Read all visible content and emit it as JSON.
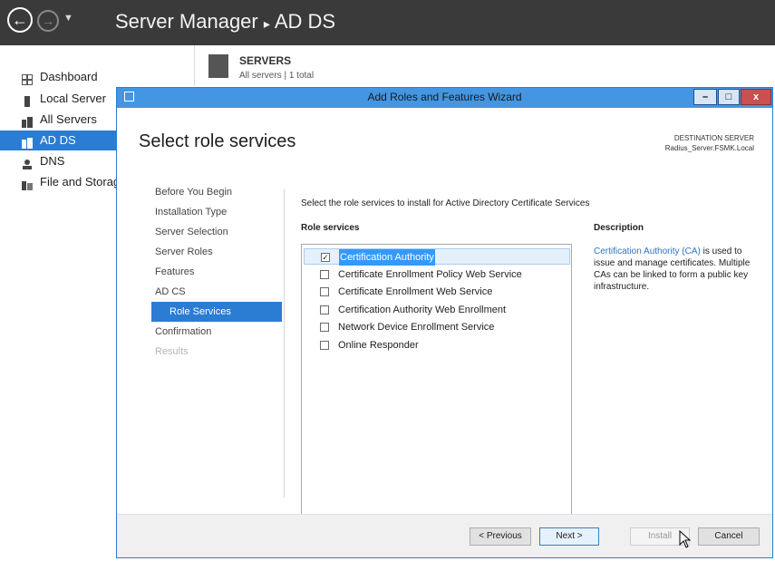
{
  "server_manager": {
    "breadcrumb_app": "Server Manager",
    "breadcrumb_sep": "▸",
    "breadcrumb_page": "AD DS"
  },
  "sidebar": {
    "items": [
      {
        "label": "Dashboard",
        "icon": "dashboard-icon"
      },
      {
        "label": "Local Server",
        "icon": "local-server-icon"
      },
      {
        "label": "All Servers",
        "icon": "all-servers-icon"
      },
      {
        "label": "AD DS",
        "icon": "ad-ds-icon",
        "active": true
      },
      {
        "label": "DNS",
        "icon": "dns-icon"
      },
      {
        "label": "File and Storag",
        "icon": "file-storage-icon"
      }
    ]
  },
  "servers_tile": {
    "title": "SERVERS",
    "subtitle": "All servers | 1 total"
  },
  "wizard": {
    "title": "Add Roles and Features Wizard",
    "controls": {
      "minimize": "–",
      "maximize": "□",
      "close": "x"
    },
    "heading": "Select role services",
    "destination_label": "DESTINATION SERVER",
    "destination_server": "Radius_Server.FSMK.Local",
    "steps": [
      {
        "label": "Before You Begin",
        "state": "normal"
      },
      {
        "label": "Installation Type",
        "state": "normal"
      },
      {
        "label": "Server Selection",
        "state": "normal"
      },
      {
        "label": "Server Roles",
        "state": "normal"
      },
      {
        "label": "Features",
        "state": "normal"
      },
      {
        "label": "AD CS",
        "state": "normal"
      },
      {
        "label": "Role Services",
        "state": "current"
      },
      {
        "label": "Confirmation",
        "state": "normal"
      },
      {
        "label": "Results",
        "state": "disabled"
      }
    ],
    "instruction": "Select the role services to install for Active Directory Certificate Services",
    "role_services_header": "Role services",
    "role_services": [
      {
        "label": "Certification Authority",
        "checked": true,
        "selected": true
      },
      {
        "label": "Certificate Enrollment Policy Web Service",
        "checked": false
      },
      {
        "label": "Certificate Enrollment Web Service",
        "checked": false
      },
      {
        "label": "Certification Authority Web Enrollment",
        "checked": false
      },
      {
        "label": "Network Device Enrollment Service",
        "checked": false
      },
      {
        "label": "Online Responder",
        "checked": false
      }
    ],
    "description_header": "Description",
    "description_link": "Certification Authority (CA)",
    "description_text": " is used to issue and manage certificates. Multiple CAs can be linked to form a public key infrastructure.",
    "buttons": {
      "previous": "< Previous",
      "next": "Next >",
      "install": "Install",
      "cancel": "Cancel"
    }
  },
  "colors": {
    "accent": "#2b7cd3",
    "titlebar": "#3a3a3a",
    "wizard_titlebar": "#4496e2",
    "link": "#2f73c0"
  }
}
